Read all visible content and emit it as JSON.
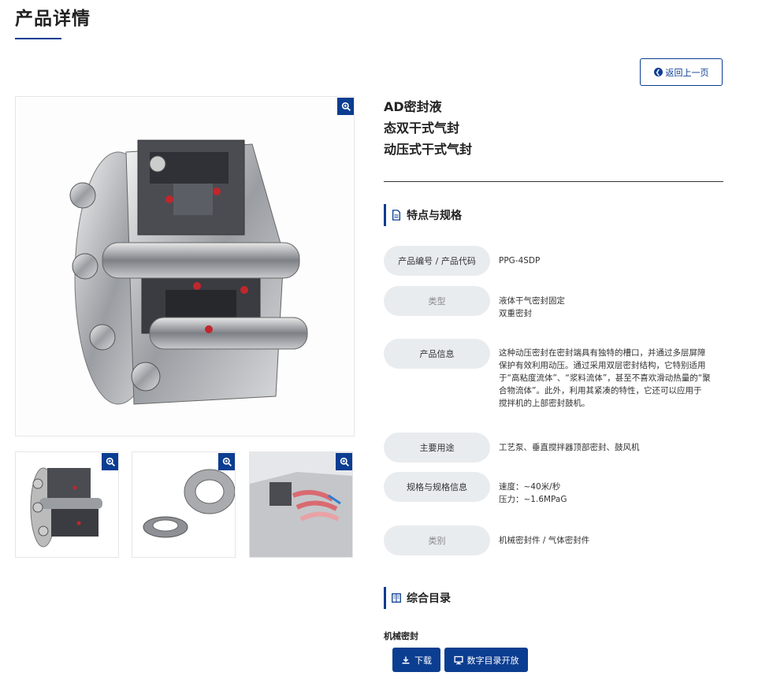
{
  "header": {
    "title": "产品详情"
  },
  "back_button": {
    "label": "返回上一页"
  },
  "product": {
    "title_lines": [
      "AD密封液",
      "态双干式气封",
      "动压式干式气封"
    ]
  },
  "specs_section": {
    "heading": "特点与规格",
    "rows": [
      {
        "label": "产品编号 / 产品代码",
        "value_lines": [
          "PPG-4SDP"
        ]
      },
      {
        "label": "类型",
        "value_lines": [
          "液体干气密封固定",
          "双重密封"
        ]
      },
      {
        "label": "产品信息",
        "value_lines": [
          "这种动压密封在密封端具有独特的槽口，并通过多层屏障",
          "保护有效利用动压。通过采用双层密封结构，它特别适用",
          "于“高粘度流体”、“浆料流体”，甚至不喜欢滑动热量的“聚",
          "合物流体”。此外，利用其紧凑的特性，它还可以应用于",
          "搅拌机的上部密封鼓机。"
        ]
      },
      {
        "label": "主要用途",
        "value_lines": [
          "工艺泵、垂直搅拌器顶部密封、鼓风机"
        ]
      },
      {
        "label": "规格与规格信息",
        "value_lines": [
          "速度：~40米/秒",
          "压力：~1.6MPaG"
        ]
      },
      {
        "label": "类别",
        "value_lines": [
          "机械密封件 / 气体密封件"
        ]
      }
    ]
  },
  "catalog_section": {
    "heading": "综合目录",
    "subheading": "机械密封",
    "download_label": "下载",
    "digital_label": "数字目录开放"
  },
  "colors": {
    "accent": "#0b3d91",
    "pill": "#e9ecef"
  },
  "icons": {
    "zoom": "zoom-in-icon",
    "back": "arrow-left-circle-icon",
    "doc": "document-icon",
    "book": "book-icon",
    "download": "download-icon",
    "monitor": "monitor-icon"
  }
}
